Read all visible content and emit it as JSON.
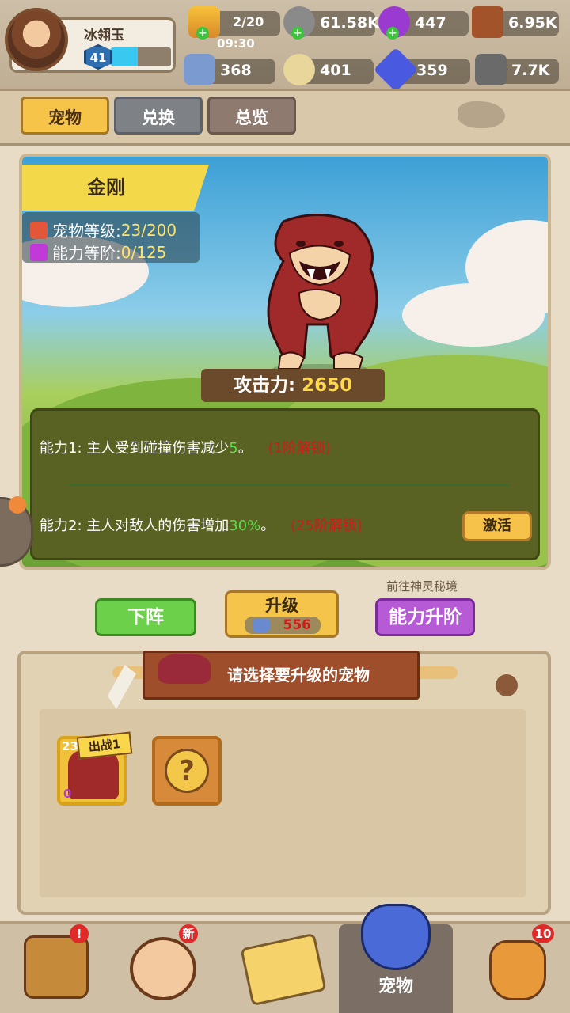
{
  "player": {
    "name": "冰翎玉",
    "level": "41",
    "xp_fraction": 0.45
  },
  "resources": {
    "stamina": "2/20",
    "stamina_timer": "09:30",
    "stone": "61.58K",
    "gem_purple": "447",
    "wood": "6.95K",
    "bone": "368",
    "egg": "401",
    "crystal": "359",
    "ore": "7.7K"
  },
  "tabs": {
    "pet": "宠物",
    "exchange": "兑换",
    "overview": "总览"
  },
  "pet": {
    "name": "金刚",
    "level_label": "宠物等级:",
    "level_value": "23/200",
    "rank_label": "能力等阶:",
    "rank_value": "0/125",
    "attack_label": "攻击力:",
    "attack_value": "2650"
  },
  "skills": {
    "s1_prefix": "能力1:  主人受到碰撞伤害减少",
    "s1_value": "5",
    "s1_suffix": "。",
    "s1_lock": "(1阶解锁)",
    "s2_prefix": "能力2:  主人对敌人的伤害增加",
    "s2_value": "30%",
    "s2_suffix": "。",
    "s2_lock": "(25阶解锁)",
    "activate": "激活"
  },
  "actions": {
    "retire": "下阵",
    "upgrade": "升级",
    "upgrade_cost": "556",
    "rank_up": "能力升阶",
    "portal_note": "前往神灵秘境"
  },
  "selection": {
    "title": "请选择要升级的宠物",
    "slot1_level": "23",
    "slot1_tag": "出战1",
    "slot1_rank": "0"
  },
  "bottom_nav": {
    "active_label": "宠物",
    "badge_alert": "!",
    "badge_new": "新",
    "badge_count": "10"
  }
}
